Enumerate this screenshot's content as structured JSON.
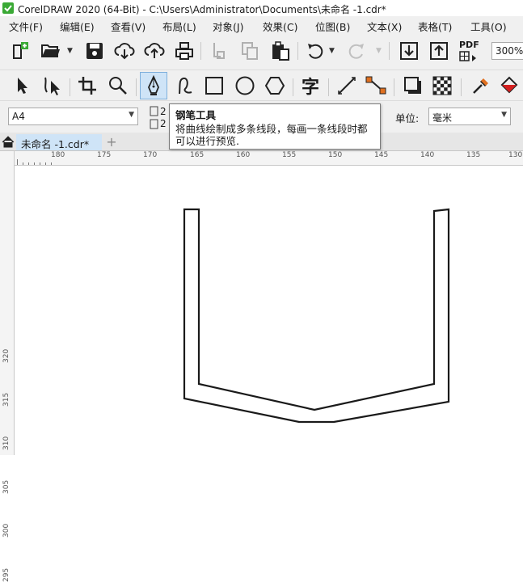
{
  "window": {
    "title": "CorelDRAW 2020 (64-Bit) - C:\\Users\\Administrator\\Documents\\未命名 -1.cdr*"
  },
  "menu": [
    {
      "label": "文件(F)"
    },
    {
      "label": "编辑(E)"
    },
    {
      "label": "查看(V)"
    },
    {
      "label": "布局(L)"
    },
    {
      "label": "对象(J)"
    },
    {
      "label": "效果(C)"
    },
    {
      "label": "位图(B)"
    },
    {
      "label": "文本(X)"
    },
    {
      "label": "表格(T)"
    },
    {
      "label": "工具(O)"
    }
  ],
  "toolbar": {
    "zoom_value": "300%",
    "pdf_label": "PDF"
  },
  "tools": {
    "text_tool_glyph": "字"
  },
  "property_bar": {
    "page_size": "A4",
    "width_prefix": "2",
    "height_prefix": "2",
    "units_label": "单位:",
    "units_value": "毫米"
  },
  "tooltip": {
    "title": "钢笔工具",
    "line1": "将曲线绘制成多条线段，每画一条线段时都",
    "line2": "可以进行预览."
  },
  "tabs": {
    "document_tab": "未命名 -1.cdr*",
    "add_tab": "+"
  },
  "rulers": {
    "horizontal": [
      "180",
      "175",
      "170",
      "165",
      "160",
      "155",
      "150",
      "145",
      "140",
      "135",
      "130"
    ],
    "vertical": [
      "320",
      "315",
      "310",
      "305",
      "300",
      "295"
    ]
  },
  "colors": {
    "accent_tab": "#cfe4f7",
    "selected_tool": "#cfe4f7",
    "logo_green": "#3aa935"
  },
  "icons": [
    "new-icon",
    "open-icon",
    "save-icon",
    "cloud-download-icon",
    "cloud-upload-icon",
    "print-icon",
    "cut-icon",
    "copy-icon",
    "paste-icon",
    "undo-icon",
    "redo-icon",
    "import-icon",
    "export-icon",
    "pdf-icon",
    "pick-tool-icon",
    "shape-tool-icon",
    "crop-tool-icon",
    "zoom-tool-icon",
    "pen-tool-icon",
    "freehand-tool-icon",
    "rectangle-tool-icon",
    "ellipse-tool-icon",
    "polygon-tool-icon",
    "text-tool-icon",
    "dimension-tool-icon",
    "connector-tool-icon",
    "shadow-tool-icon",
    "transparency-tool-icon",
    "eyedropper-tool-icon",
    "fill-tool-icon"
  ]
}
